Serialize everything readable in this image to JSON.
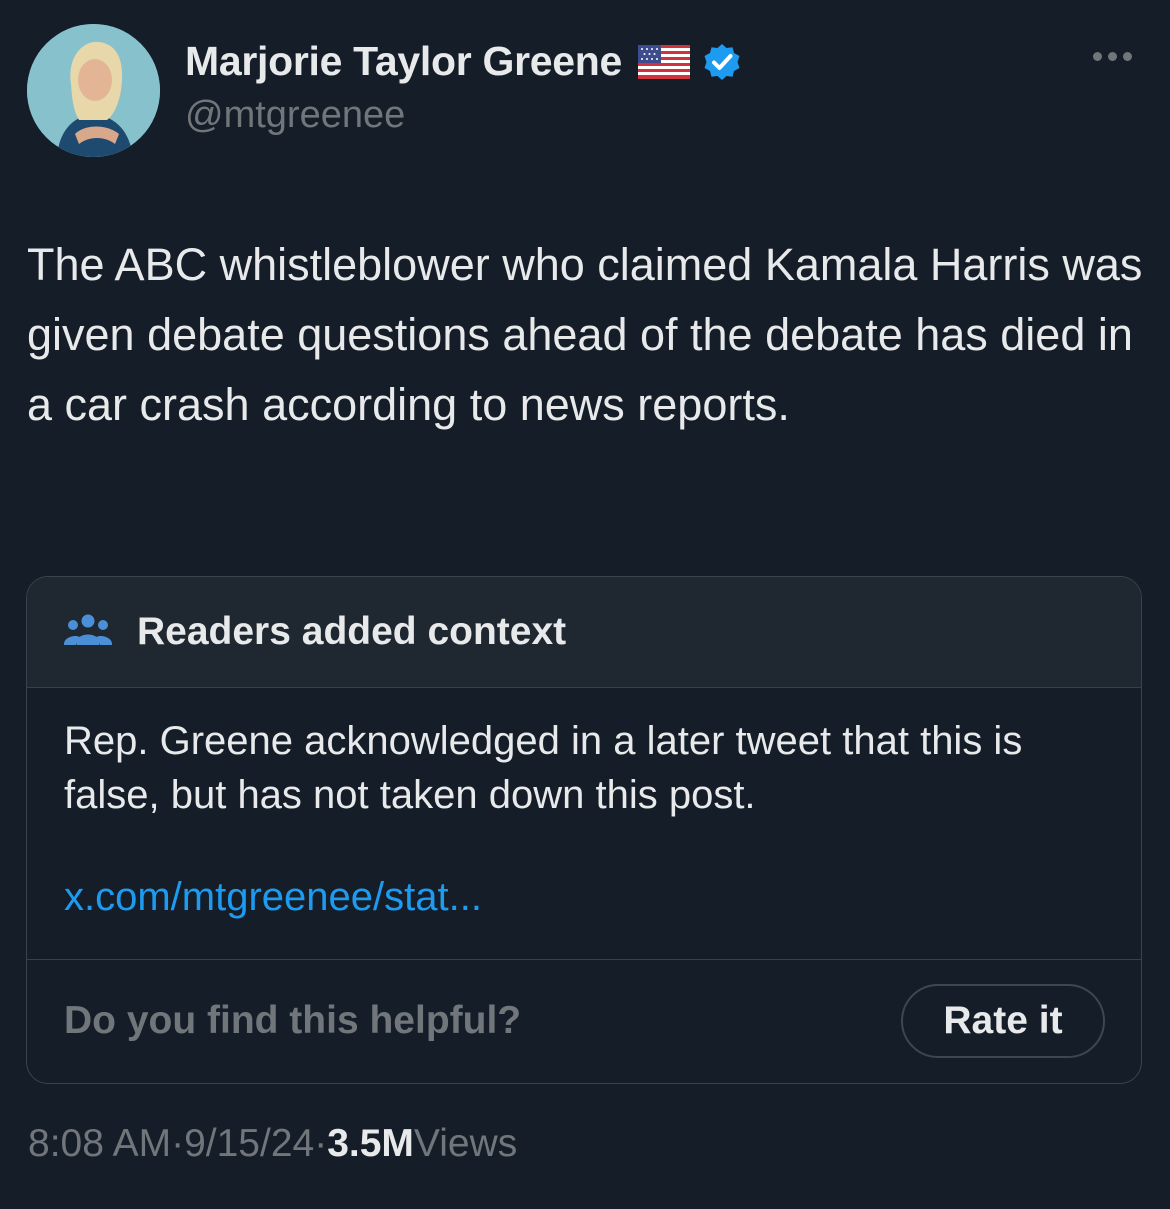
{
  "author": {
    "name": "Marjorie Taylor Greene",
    "handle": "@mtgreenee",
    "flag_icon": "us-flag-emoji",
    "verified_icon": "verified-badge-icon",
    "verified_color": "#1d9bf0"
  },
  "tweet": {
    "text": "The ABC whistleblower who claimed Kamala Harris was given debate questions ahead of the debate has died in a car crash according to news reports."
  },
  "community_note": {
    "title": "Readers added context",
    "icon": "people-group-icon",
    "body": "Rep. Greene acknowledged in a later tweet that this is false, but has not taken down this post.",
    "link_text": "x.com/mtgreenee/stat...",
    "helpful_prompt": "Do you find this helpful?",
    "rate_button_label": "Rate it"
  },
  "meta": {
    "time": "8:08 AM",
    "separator": "·",
    "date": "9/15/24",
    "views_count": "3.5M",
    "views_label": "Views"
  },
  "colors": {
    "background": "#151d28",
    "text": "#e7e9ea",
    "muted": "#71767b",
    "link": "#1d9bf0"
  }
}
